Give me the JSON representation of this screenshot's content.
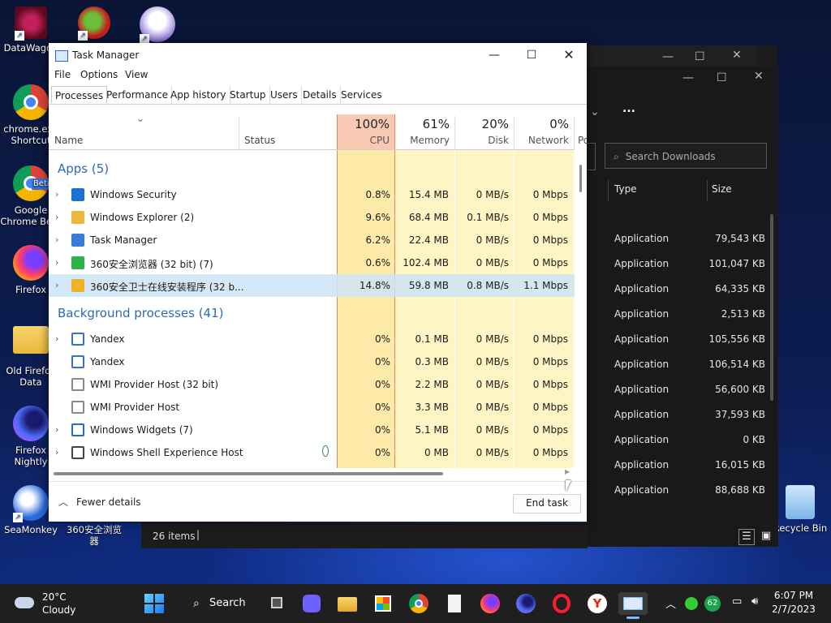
{
  "desktop": {
    "icons": [
      {
        "label": "DataWagon"
      },
      {
        "label": "chrome.exe Shortcut"
      },
      {
        "label": "Google Chrome Beta"
      },
      {
        "label": "Firefox"
      },
      {
        "label": "Old Firefox Data"
      },
      {
        "label": "Firefox Nightly"
      },
      {
        "label": "SeaMonkey"
      },
      {
        "label": "360安全浏览器"
      },
      {
        "label": "Recycle Bin"
      }
    ]
  },
  "explorer": {
    "search_placeholder": "Search Downloads",
    "more_label": "...",
    "col_type": "Type",
    "col_size": "Size",
    "rows": [
      {
        "type": "Application",
        "size": "79,543 KB"
      },
      {
        "type": "Application",
        "size": "101,047 KB"
      },
      {
        "type": "Application",
        "size": "64,335 KB"
      },
      {
        "type": "Application",
        "size": "2,513 KB"
      },
      {
        "type": "Application",
        "size": "105,556 KB"
      },
      {
        "type": "Application",
        "size": "106,514 KB"
      },
      {
        "type": "Application",
        "size": "56,600 KB"
      },
      {
        "type": "Application",
        "size": "37,593 KB"
      },
      {
        "type": "Application",
        "size": "0 KB"
      },
      {
        "type": "Application",
        "size": "16,015 KB"
      },
      {
        "type": "Application",
        "size": "88,688 KB"
      }
    ],
    "status": "26 items"
  },
  "taskmanager": {
    "title": "Task Manager",
    "menu": [
      "File",
      "Options",
      "View"
    ],
    "tabs": [
      "Processes",
      "Performance",
      "App history",
      "Startup",
      "Users",
      "Details",
      "Services"
    ],
    "active_tab": "Processes",
    "columns": {
      "name": "Name",
      "status": "Status",
      "cpu": {
        "pct": "100%",
        "label": "CPU"
      },
      "memory": {
        "pct": "61%",
        "label": "Memory"
      },
      "disk": {
        "pct": "20%",
        "label": "Disk"
      },
      "network": {
        "pct": "0%",
        "label": "Network"
      },
      "power": "Po"
    },
    "groups": {
      "apps": "Apps (5)",
      "background": "Background processes (41)"
    },
    "apps": [
      {
        "name": "Windows Security",
        "cpu": "0.8%",
        "mem": "15.4 MB",
        "disk": "0 MB/s",
        "net": "0 Mbps",
        "expand": true
      },
      {
        "name": "Windows Explorer (2)",
        "cpu": "9.6%",
        "mem": "68.4 MB",
        "disk": "0.1 MB/s",
        "net": "0 Mbps",
        "expand": true
      },
      {
        "name": "Task Manager",
        "cpu": "6.2%",
        "mem": "22.4 MB",
        "disk": "0 MB/s",
        "net": "0 Mbps",
        "expand": true
      },
      {
        "name": "360安全浏览器 (32 bit) (7)",
        "cpu": "0.6%",
        "mem": "102.4 MB",
        "disk": "0 MB/s",
        "net": "0 Mbps",
        "expand": true
      },
      {
        "name": "360安全卫士在线安装程序 (32 b...",
        "cpu": "14.8%",
        "mem": "59.8 MB",
        "disk": "0.8 MB/s",
        "net": "1.1 Mbps",
        "expand": true,
        "selected": true
      }
    ],
    "background": [
      {
        "name": "Yandex",
        "cpu": "0%",
        "mem": "0.1 MB",
        "disk": "0 MB/s",
        "net": "0 Mbps",
        "expand": true
      },
      {
        "name": "Yandex",
        "cpu": "0%",
        "mem": "0.3 MB",
        "disk": "0 MB/s",
        "net": "0 Mbps",
        "expand": false
      },
      {
        "name": "WMI Provider Host (32 bit)",
        "cpu": "0%",
        "mem": "2.2 MB",
        "disk": "0 MB/s",
        "net": "0 Mbps",
        "expand": false
      },
      {
        "name": "WMI Provider Host",
        "cpu": "0%",
        "mem": "3.3 MB",
        "disk": "0 MB/s",
        "net": "0 Mbps",
        "expand": false
      },
      {
        "name": "Windows Widgets (7)",
        "cpu": "0%",
        "mem": "5.1 MB",
        "disk": "0 MB/s",
        "net": "0 Mbps",
        "expand": true
      },
      {
        "name": "Windows Shell Experience Host",
        "cpu": "0%",
        "mem": "0 MB",
        "disk": "0 MB/s",
        "net": "0 Mbps",
        "expand": true,
        "status_icon": "leaf-icon"
      }
    ],
    "fewer_details": "Fewer details",
    "end_task": "End task"
  },
  "taskbar": {
    "weather_temp": "20°C",
    "weather_text": "Cloudy",
    "search_label": "Search",
    "battery_badge": "62",
    "time": "6:07 PM",
    "date": "2/7/2023"
  },
  "colors": {
    "cpu_header": "#f9c9b4",
    "cpu_cell": "#fde9a8",
    "cell_light": "#fff4c4",
    "selected_row": "#cce4f7",
    "group_text": "#2c6bb4"
  }
}
